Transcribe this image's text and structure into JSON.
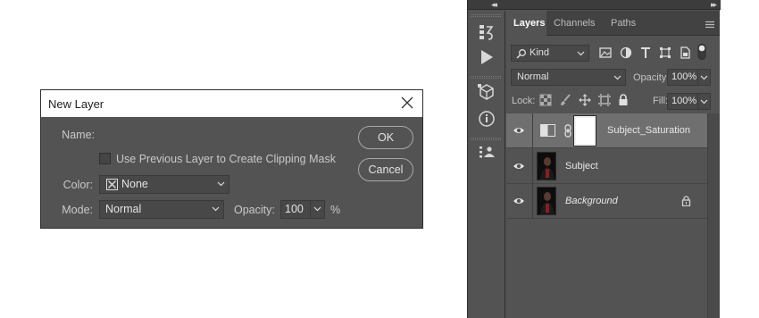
{
  "dialog": {
    "title": "New Layer",
    "name_label": "Name:",
    "name_value": "Subject_Saturation",
    "clip_label": "Use Previous Layer to Create Clipping Mask",
    "color_label": "Color:",
    "color_value": "None",
    "mode_label": "Mode:",
    "mode_value": "Normal",
    "opacity_label": "Opacity:",
    "opacity_value": "100",
    "opacity_unit": "%",
    "ok_label": "OK",
    "cancel_label": "Cancel"
  },
  "panel": {
    "collapse_left": "◂◂",
    "collapse_right": "▸▸",
    "tabs": [
      {
        "label": "Layers"
      },
      {
        "label": "Channels"
      },
      {
        "label": "Paths"
      }
    ],
    "kind_label": "Kind",
    "blend_mode": "Normal",
    "opacity_label": "Opacity:",
    "opacity_value": "100%",
    "lock_label": "Lock:",
    "fill_label": "Fill:",
    "fill_value": "100%",
    "layers": [
      {
        "name": "Subject_Saturation"
      },
      {
        "name": "Subject"
      },
      {
        "name": "Background"
      }
    ]
  },
  "colors": {
    "panel_bg": "#535353",
    "selected_row": "#6f6f6f",
    "focus_border": "#3d78c9"
  }
}
